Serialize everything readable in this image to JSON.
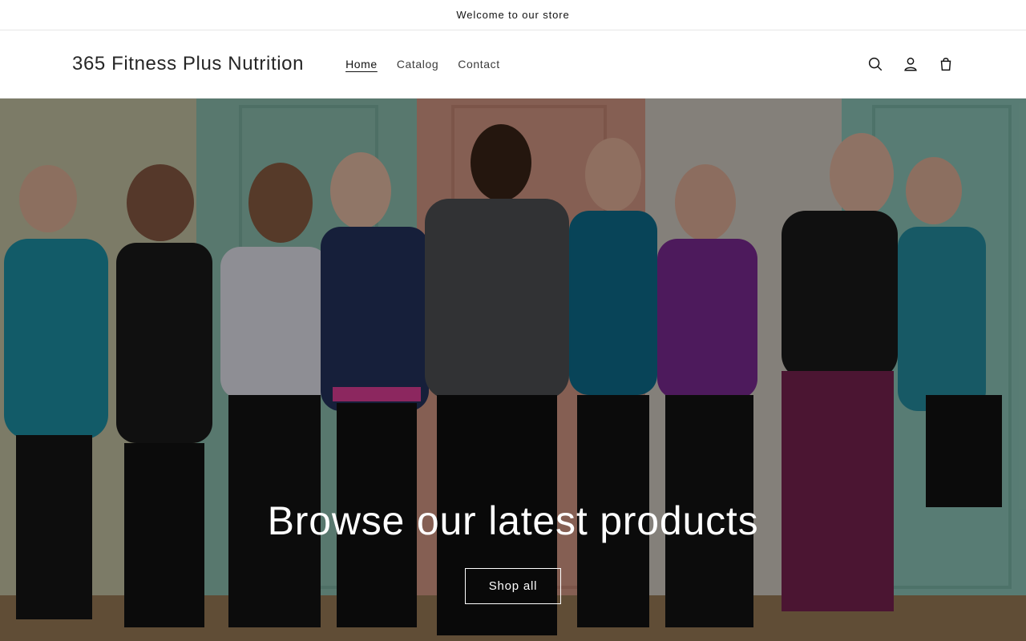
{
  "announcement": {
    "text": "Welcome to our store"
  },
  "header": {
    "logo": "365 Fitness Plus Nutrition",
    "nav": [
      {
        "label": "Home",
        "active": true
      },
      {
        "label": "Catalog",
        "active": false
      },
      {
        "label": "Contact",
        "active": false
      }
    ],
    "icons": [
      "search-icon",
      "account-icon",
      "cart-icon"
    ]
  },
  "hero": {
    "image": "group-of-women-in-workout-clothes",
    "title": "Browse our latest products",
    "button": "Shop all"
  },
  "colors": {
    "text": "#121212",
    "border": "#e6e6e6",
    "hero_text": "#ffffff"
  }
}
